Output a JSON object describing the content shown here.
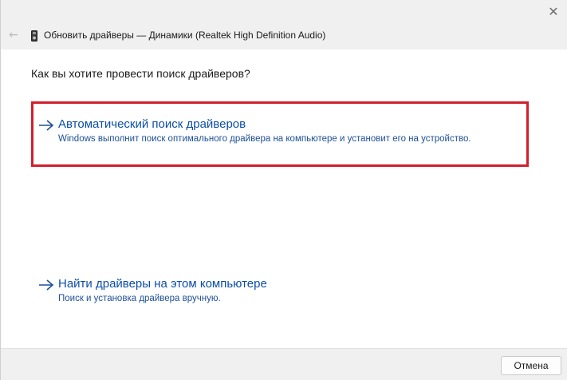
{
  "window": {
    "title": "Обновить драйверы — Динамики (Realtek High Definition Audio)",
    "close_glyph": "✕",
    "back_glyph": "←"
  },
  "main": {
    "question": "Как вы хотите провести поиск драйверов?",
    "options": [
      {
        "title": "Автоматический поиск драйверов",
        "description": "Windows выполнит поиск оптимального драйвера на компьютере и установит его на устройство.",
        "highlighted": true
      },
      {
        "title": "Найти драйверы на этом компьютере",
        "description": "Поиск и установка драйвера вручную.",
        "highlighted": false
      }
    ],
    "highlight_color": "#d0202c",
    "link_color": "#0b4da8"
  },
  "footer": {
    "cancel_label": "Отмена"
  },
  "icons": {
    "close": "close-icon",
    "back": "back-arrow-icon",
    "device": "speaker-device-icon",
    "option_arrow": "right-arrow-icon"
  }
}
